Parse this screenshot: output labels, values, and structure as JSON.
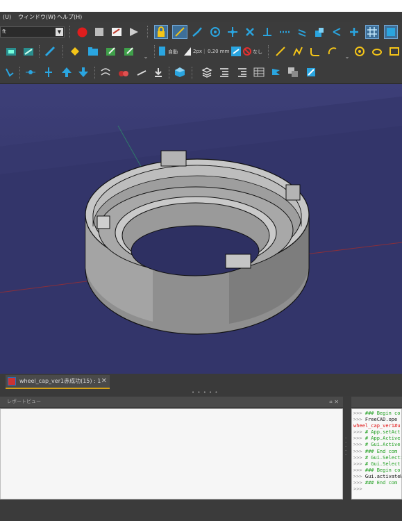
{
  "menubar": {
    "items": [
      "(U)",
      "ウィンドウ(W)",
      "ヘルプ(H)"
    ]
  },
  "toolbar1": {
    "workbench_combo": "ft",
    "icons": [
      "record-macro-icon",
      "stop-macro-icon",
      "macros-icon",
      "execute-macro-icon",
      "lock-icon",
      "line-icon",
      "wire-icon",
      "circle-icon",
      "move-icon",
      "delete-icon",
      "perpendicular-icon",
      "dotted-line-icon",
      "arrow-icon",
      "shapes-icon",
      "snap-icon",
      "plus-icon",
      "grid-icon",
      "cube-icon"
    ]
  },
  "toolbar2": {
    "auto_label": "自動",
    "line_width_label": "2px",
    "dimension_label": "0.20 mm",
    "none_label": "なし"
  },
  "document": {
    "tab_label": "wheel_cap_ver1赤成功(15) : 1"
  },
  "report_view": {
    "title": "レポートビュー"
  },
  "python_console": {
    "lines": [
      {
        "prompt": ">>>",
        "text": "### Begin co",
        "color": "#1e9e1e"
      },
      {
        "prompt": ">>>",
        "text": "FreeCAD.ope",
        "color": "#111111"
      },
      {
        "prompt": "",
        "text": "wheel_cap_ver1#u",
        "color": "#e01010"
      },
      {
        "prompt": ">>>",
        "text": "# App.setAct",
        "color": "#1e9e1e"
      },
      {
        "prompt": ">>>",
        "text": "# App.Active",
        "color": "#1e9e1e"
      },
      {
        "prompt": ">>>",
        "text": "# Gui.Active",
        "color": "#1e9e1e"
      },
      {
        "prompt": ">>>",
        "text": "### End com",
        "color": "#1e9e1e"
      },
      {
        "prompt": ">>>",
        "text": "# Gui.Selecti",
        "color": "#1e9e1e"
      },
      {
        "prompt": ">>>",
        "text": "# Gui.Select",
        "color": "#1e9e1e"
      },
      {
        "prompt": ">>>",
        "text": "### Begin co",
        "color": "#1e9e1e"
      },
      {
        "prompt": ">>>",
        "text": "Gui.activateW",
        "color": "#111111"
      },
      {
        "prompt": ">>>",
        "text": "### End com",
        "color": "#1e9e1e"
      },
      {
        "prompt": ">>>",
        "text": "",
        "color": "#111111"
      }
    ]
  }
}
